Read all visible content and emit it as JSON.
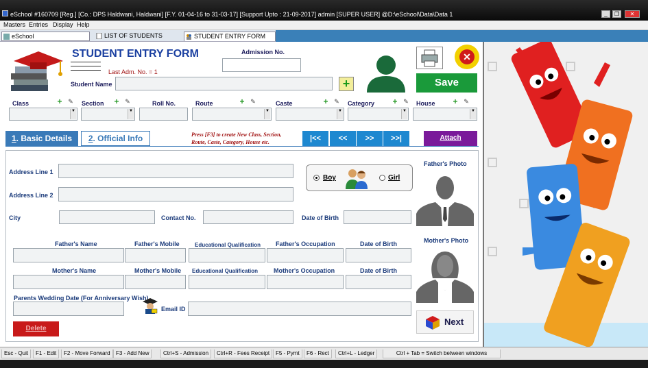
{
  "window": {
    "title": "eSchool #160709 [Reg.] [Co.: DPS Haldwani, Haldwani] [F.Y. 01-04-16 to 31-03-17]  [Support Upto : 21-09-2017]  admin [SUPER USER]  @D:\\eSchool\\Data\\Data 1",
    "controls": [
      "_",
      "❐",
      "✕"
    ]
  },
  "menu": [
    "Masters",
    "Entries",
    "Display",
    "Help"
  ],
  "tabs": [
    {
      "label": "eSchool"
    },
    {
      "label": "LIST OF STUDENTS"
    },
    {
      "label": "STUDENT ENTRY FORM"
    }
  ],
  "header": {
    "title": "STUDENT ENTRY FORM",
    "last_adm": "Last Adm. No. = 1",
    "admission_label": "Admission No.",
    "admission_value": "",
    "student_name_label": "Student Name",
    "student_name_value": "",
    "save_label": "Save"
  },
  "selectors": [
    {
      "label": "Class"
    },
    {
      "label": "Section"
    },
    {
      "label": "Roll No."
    },
    {
      "label": "Route"
    },
    {
      "label": "Caste"
    },
    {
      "label": "Category"
    },
    {
      "label": "House"
    }
  ],
  "subtabs": {
    "basic": {
      "num": "1",
      "text": ". Basic Details"
    },
    "official": {
      "num": "2",
      "text": ". Official Info"
    }
  },
  "hint": "Press [F3] to create New Class, Section, Route, Caste, Category, House etc.",
  "nav": [
    "|<<",
    "<<",
    ">>",
    ">>|"
  ],
  "attach_label": "Attach",
  "address": {
    "line1_label": "Address Line 1",
    "line2_label": "Address Line 2",
    "city_label": "City",
    "contact_label": "Contact No.",
    "dob_label": "Date of Birth"
  },
  "gender": {
    "boy": "Boy",
    "girl": "Girl",
    "selected": "Boy"
  },
  "photos": {
    "father": "Father's Photo",
    "mother": "Mother's Photo"
  },
  "parents": {
    "father_cols": [
      "Father's Name",
      "Father's Mobile",
      "Educational Qualification",
      "Father's Occupation",
      "Date of Birth"
    ],
    "mother_cols": [
      "Mother's  Name",
      "Mother's Mobile",
      "Educational Qualification",
      "Mother's Occupation",
      "Date of Birth"
    ],
    "wedding_label": "Parents Wedding Date (For Anniversary Wish)",
    "email_label": "Email ID"
  },
  "delete_label": "Delete",
  "next_label": "Next",
  "footer_keys": [
    "Esc - Quit",
    "F1 - Edit",
    "F2 - Move Forward",
    "F3 - Add New",
    "Ctrl+S - Admission",
    "Ctrl+R - Fees Receipt",
    "F5 - Pymt",
    "F6 - Rect",
    "Ctrl+L - Ledger",
    "Ctrl + Tab = Switch between windows"
  ],
  "colors": {
    "title_blue": "#1a3fa0",
    "save_green": "#1a9a3a",
    "nav_blue": "#1e88d0",
    "attach_purple": "#7a1a9a",
    "delete_red": "#c81a1a"
  }
}
